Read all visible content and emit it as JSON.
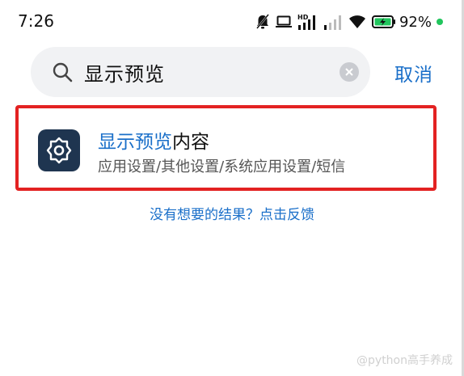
{
  "status_bar": {
    "time": "7:26",
    "battery_percent": "92%",
    "icons": [
      "notifications-off-icon",
      "laptop-icon",
      "hd-signal-icon",
      "signal-icon",
      "wifi-icon",
      "battery-charging-icon"
    ],
    "accent_green": "#21c55d"
  },
  "search": {
    "query": "显示预览",
    "cancel_label": "取消",
    "clear_icon": "clear-icon"
  },
  "results": [
    {
      "title_highlight": "显示预览",
      "title_rest": "内容",
      "path": "应用设置/其他设置/系统应用设置/短信",
      "icon": "settings-gear-icon"
    }
  ],
  "feedback_link": "没有想要的结果？点击反馈",
  "watermark": "@python高手养成",
  "colors": {
    "accent_blue": "#1a6fc9",
    "highlight_border": "#e32222",
    "icon_bg": "#1f3550"
  }
}
